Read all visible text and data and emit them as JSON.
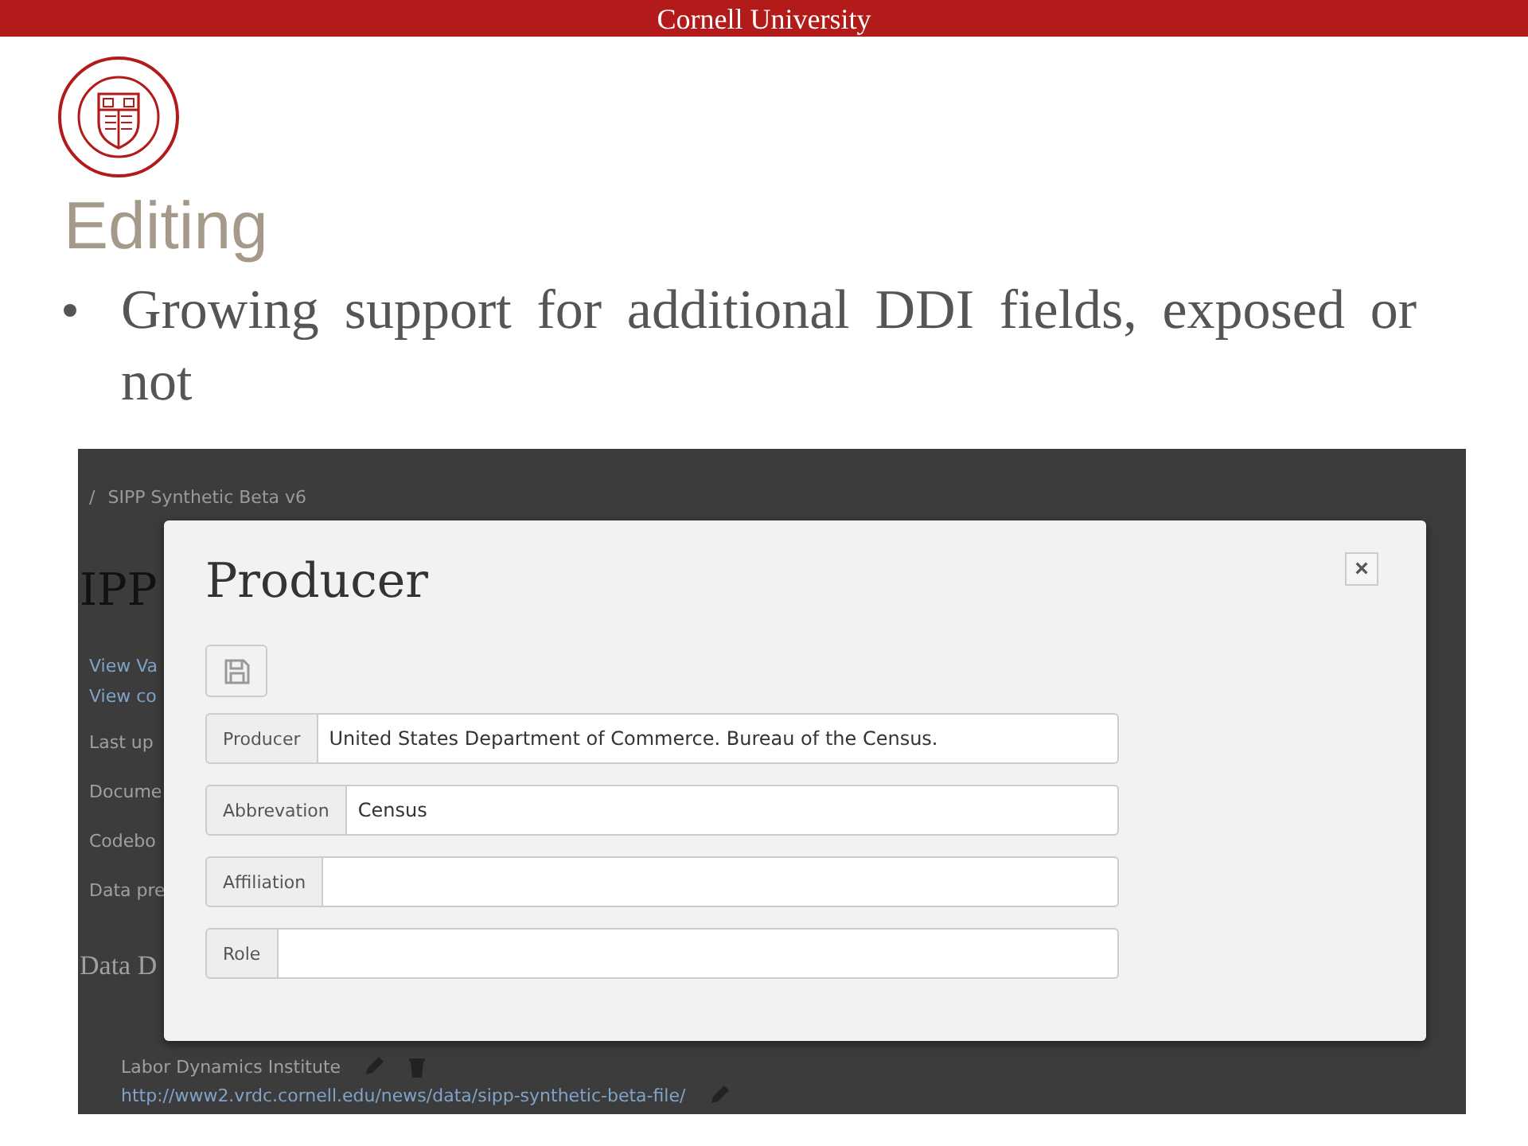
{
  "header": {
    "title": "Cornell University"
  },
  "slide": {
    "title": "Editing",
    "bullets": [
      "Growing support for additional DDI fields, exposed or not"
    ]
  },
  "app": {
    "page": {
      "breadcrumb": [
        "/",
        "SIPP Synthetic Beta v6"
      ],
      "heading": "IPP",
      "links": [
        "View Va",
        "View co"
      ],
      "lines": [
        "Last up",
        "Docume",
        "Codebo",
        "Data pre"
      ],
      "section_heading": "Data D",
      "entries": [
        {
          "kind": "text",
          "text": "Labor Dynamics Institute"
        },
        {
          "kind": "link",
          "text": "http://www2.vrdc.cornell.edu/news/data/sipp-synthetic-beta-file/"
        }
      ]
    },
    "modal": {
      "title": "Producer",
      "close": "×",
      "fields": [
        {
          "label": "Producer",
          "value": "United States Department of Commerce. Bureau of the Census."
        },
        {
          "label": "Abbrevation",
          "value": "Census"
        },
        {
          "label": "Affiliation"
        },
        {
          "label": "Role"
        }
      ]
    }
  }
}
